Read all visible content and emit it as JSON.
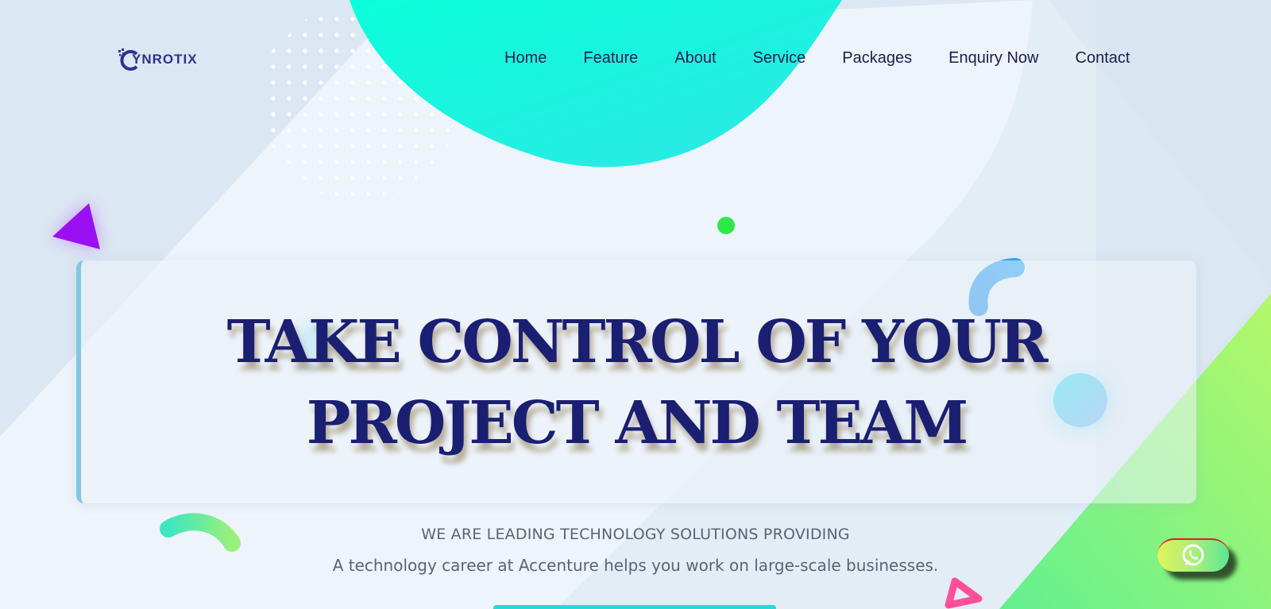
{
  "brand": {
    "logo_text": "YNROTIX"
  },
  "nav": {
    "items": [
      {
        "label": "Home"
      },
      {
        "label": "Feature"
      },
      {
        "label": "About"
      },
      {
        "label": "Service"
      },
      {
        "label": "Packages"
      },
      {
        "label": "Enquiry Now"
      },
      {
        "label": "Contact"
      }
    ]
  },
  "hero": {
    "title_line1": "TAKE CONTROL OF YOUR",
    "title_line2": "PROJECT AND TEAM",
    "subtitle_upper": "WE ARE LEADING TECHNOLOGY SOLUTIONS PROVIDING",
    "subtitle_lower": "A technology career at Accenture helps you work on large-scale businesses."
  },
  "whatsapp": {
    "icon": "whatsapp-icon"
  },
  "colors": {
    "title": "#1a1f72",
    "nav_text": "#1a1f4e",
    "cyan_blob": "#0ff2dc",
    "green_corner": "#a6f57c",
    "purple_triangle": "#9b10f2",
    "pink_triangle": "#ff4f9a",
    "card_accent": "#7ec9e4"
  }
}
